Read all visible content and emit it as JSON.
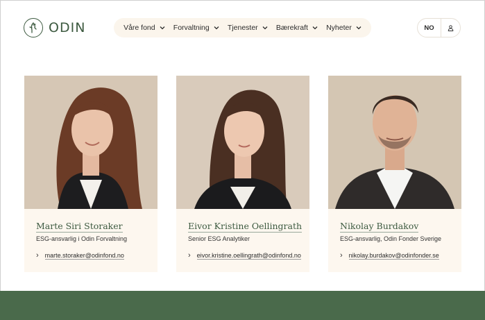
{
  "brand": {
    "name": "ODIN",
    "color": "#3d5a40"
  },
  "nav": {
    "items": [
      {
        "label": "Våre fond"
      },
      {
        "label": "Forvaltning"
      },
      {
        "label": "Tjenester"
      },
      {
        "label": "Bærekraft"
      },
      {
        "label": "Nyheter"
      }
    ]
  },
  "utility": {
    "language": "NO",
    "user_icon": "user-icon"
  },
  "people": [
    {
      "name": "Marte Siri Storaker",
      "role": "ESG-ansvarlig i Odin Forvaltning",
      "email": "marte.storaker@odinfond.no"
    },
    {
      "name": "Eivor Kristine Oellingrath",
      "role": "Senior ESG Analytiker",
      "email": "eivor.kristine.oellingrath@odinfond.no"
    },
    {
      "name": "Nikolay Burdakov",
      "role": "ESG-ansvarlig, Odin Fonder Sverige",
      "email": "nikolay.burdakov@odinfonder.se"
    }
  ],
  "colors": {
    "card_bg": "#fdf7ef",
    "nav_bg": "#fbf5ec",
    "footer_band": "#4a6a4b",
    "photo_bg": "#d9cbbb"
  }
}
